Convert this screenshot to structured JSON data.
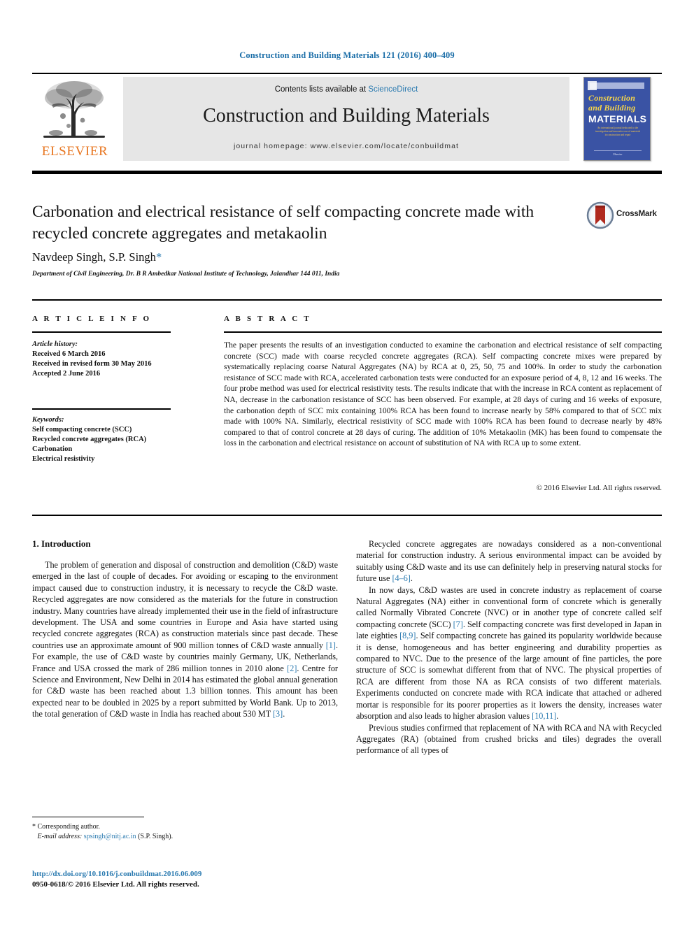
{
  "running_head": "Construction and Building Materials 121 (2016) 400–409",
  "masthead": {
    "contents_prefix": "Contents lists available at ",
    "sciencedirect": "ScienceDirect",
    "journal_title": "Construction and Building Materials",
    "homepage": "journal homepage: www.elsevier.com/locate/conbuildmat",
    "publisher": "ELSEVIER",
    "cover": {
      "line1": "Construction",
      "line2": "and Building",
      "line3": "MATERIALS",
      "blurb": "An international journal dedicated to the investigation and innovative use of materials in construction and repair",
      "footer": "Elsevier"
    }
  },
  "article": {
    "title": "Carbonation and electrical resistance of self compacting concrete made with recycled concrete aggregates and metakaolin",
    "authors": "Navdeep Singh, S.P. Singh",
    "corresponding_marker": "*",
    "affiliation": "Department of Civil Engineering, Dr. B R Ambedkar National Institute of Technology, Jalandhar 144 011, India",
    "crossmark_label": "CrossMark"
  },
  "article_info": {
    "heading": "A R T I C L E   I N F O",
    "history_label": "Article history:",
    "history": [
      "Received 6 March 2016",
      "Received in revised form 30 May 2016",
      "Accepted 2 June 2016"
    ],
    "keywords_label": "Keywords:",
    "keywords": [
      "Self compacting concrete (SCC)",
      "Recycled concrete aggregates (RCA)",
      "Carbonation",
      "Electrical resistivity"
    ]
  },
  "abstract": {
    "heading": "A B S T R A C T",
    "text": "The paper presents the results of an investigation conducted to examine the carbonation and electrical resistance of self compacting concrete (SCC) made with coarse recycled concrete aggregates (RCA). Self compacting concrete mixes were prepared by systematically replacing coarse Natural Aggregates (NA) by RCA at 0, 25, 50, 75 and 100%. In order to study the carbonation resistance of SCC made with RCA, accelerated carbonation tests were conducted for an exposure period of 4, 8, 12 and 16 weeks. The four probe method was used for electrical resistivity tests. The results indicate that with the increase in RCA content as replacement of NA, decrease in the carbonation resistance of SCC has been observed. For example, at 28 days of curing and 16 weeks of exposure, the carbonation depth of SCC mix containing 100% RCA has been found to increase nearly by 58% compared to that of SCC mix made with 100% NA. Similarly, electrical resistivity of SCC made with 100% RCA has been found to decrease nearly by 48% compared to that of control concrete at 28 days of curing. The addition of 10% Metakaolin (MK) has been found to compensate the loss in the carbonation and electrical resistance on account of substitution of NA with RCA up to some extent.",
    "copyright": "© 2016 Elsevier Ltd. All rights reserved."
  },
  "body": {
    "section_title": "1. Introduction",
    "left_paragraphs": [
      "The problem of generation and disposal of construction and demolition (C&D) waste emerged in the last of couple of decades. For avoiding or escaping to the environment impact caused due to construction industry, it is necessary to recycle the C&D waste. Recycled aggregates are now considered as the materials for the future in construction industry. Many countries have already implemented their use in the field of infrastructure development. The USA and some countries in Europe and Asia have started using recycled concrete aggregates (RCA) as construction materials since past decade. These countries use an approximate amount of 900 million tonnes of C&D waste annually [1]. For example, the use of C&D waste by countries mainly Germany, UK, Netherlands, France and USA crossed the mark of 286 million tonnes in 2010 alone [2]. Centre for Science and Environment, New Delhi in 2014 has estimated the global annual generation for C&D waste has been reached about 1.3 billion tonnes. This amount has been expected near to be doubled in 2025 by a report submitted by World Bank. Up to 2013, the total generation of C&D waste in India has reached about 530 MT [3]."
    ],
    "right_paragraphs": [
      "Recycled concrete aggregates are nowadays considered as a non-conventional material for construction industry. A serious environmental impact can be avoided by suitably using C&D waste and its use can definitely help in preserving natural stocks for future use [4–6].",
      "In now days, C&D wastes are used in concrete industry as replacement of coarse Natural Aggregates (NA) either in conventional form of concrete which is generally called Normally Vibrated Concrete (NVC) or in another type of concrete called self compacting concrete (SCC) [7]. Self compacting concrete was first developed in Japan in late eighties [8,9]. Self compacting concrete has gained its popularity worldwide because it is dense, homogeneous and has better engineering and durability properties as compared to NVC. Due to the presence of the large amount of fine particles, the pore structure of SCC is somewhat different from that of NVC. The physical properties of RCA are different from those NA as RCA consists of two different materials. Experiments conducted on concrete made with RCA indicate that attached or adhered mortar is responsible for its poorer properties as it lowers the density, increases water absorption and also leads to higher abrasion values [10,11].",
      "Previous studies confirmed that replacement of NA with RCA and NA with Recycled Aggregates (RA) (obtained from crushed bricks and tiles) degrades the overall performance of all types of"
    ]
  },
  "footer": {
    "corresponding_marker": "*",
    "corresponding_text": "Corresponding author.",
    "email_label": "E-mail address:",
    "email": "spsingh@nitj.ac.in",
    "email_owner": "(S.P. Singh).",
    "doi": "http://dx.doi.org/10.1016/j.conbuildmat.2016.06.009",
    "issn_line": "0950-0618/© 2016 Elsevier Ltd. All rights reserved."
  },
  "colors": {
    "link_blue": "#2a7ab0",
    "runhead_blue": "#1b6ea8",
    "elsevier_orange": "#e87722",
    "cover_blue": "#3a53a4",
    "masthead_grey": "#e6e6e6"
  }
}
